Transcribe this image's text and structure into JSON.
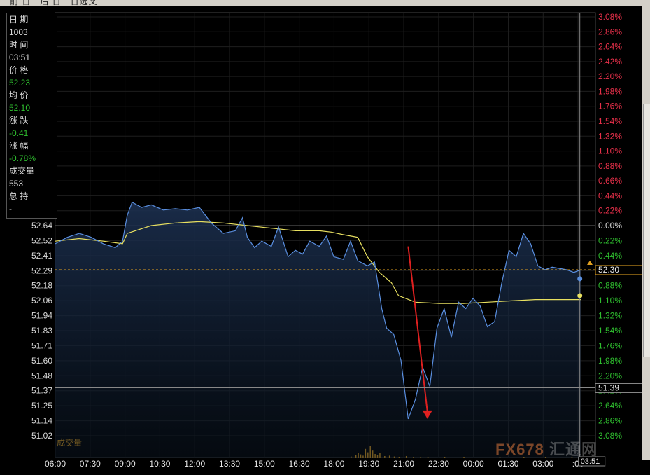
{
  "window": {
    "toolbar_text": "前 日   后 日   日选叉"
  },
  "info_panel": {
    "date_label": "日 期",
    "date_value": "1003",
    "time_label": "时 间",
    "time_value": "03:51",
    "price_label": "价 格",
    "price_value": "52.23",
    "avg_label": "均 价",
    "avg_value": "52.10",
    "change_label": "涨 跌",
    "change_value": "-0.41",
    "pct_label": "涨 幅",
    "pct_value": "-0.78%",
    "volume_label": "成交量",
    "volume_value": "553",
    "oi_label": "总 持",
    "oi_value": "-"
  },
  "volume_label": "成交量",
  "cursor_time_label": "03:51",
  "last_price_tag": "52.30",
  "crosshair_price_tag": "51.39",
  "watermark": {
    "prefix": "FX678",
    "suffix": "汇通网"
  },
  "colors": {
    "price_line": "#5a8fe0",
    "avg_line": "#e8e060",
    "up": "#e8304a",
    "down": "#2fbf2f",
    "arrow": "#e02020",
    "volume": "#e0a020"
  },
  "chart_data": {
    "type": "line",
    "title": "",
    "reference_price": 52.64,
    "ylim": [
      51.02,
      52.64
    ],
    "y_ticks_left": [
      "52.64",
      "52.52",
      "52.41",
      "52.29",
      "52.18",
      "52.06",
      "51.94",
      "51.83",
      "51.71",
      "51.60",
      "51.48",
      "51.37",
      "51.25",
      "51.14",
      "51.02"
    ],
    "y_ticks_right_up": [
      "3.08%",
      "2.86%",
      "2.64%",
      "2.42%",
      "2.20%",
      "1.98%",
      "1.76%",
      "1.54%",
      "1.32%",
      "1.10%",
      "0.88%",
      "0.66%",
      "0.44%",
      "0.22%"
    ],
    "y_ticks_right_down": [
      "0.00%",
      "0.22%",
      "0.44%",
      "0.66%",
      "0.88%",
      "1.10%",
      "1.32%",
      "1.54%",
      "1.76%",
      "1.98%",
      "2.20%",
      "2.42%",
      "2.64%",
      "2.86%",
      "3.08%"
    ],
    "x_ticks": [
      "06:00",
      "07:30",
      "09:00",
      "10:30",
      "12:00",
      "13:30",
      "15:00",
      "16:30",
      "18:00",
      "19:30",
      "21:00",
      "22:30",
      "00:00",
      "01:30",
      "03:00",
      ":00"
    ],
    "price_series": {
      "name": "价格",
      "x_hours": [
        0,
        0.5,
        1,
        1.5,
        2,
        2.5,
        2.8,
        3,
        3.2,
        3.6,
        4,
        4.5,
        5,
        5.5,
        6,
        6.5,
        7,
        7.5,
        7.8,
        8,
        8.3,
        8.6,
        9,
        9.3,
        9.7,
        10,
        10.3,
        10.6,
        11,
        11.3,
        11.6,
        12,
        12.3,
        12.6,
        13,
        13.3,
        13.6,
        13.8,
        14.1,
        14.4,
        14.7,
        15,
        15.3,
        15.6,
        15.9,
        16.2,
        16.5,
        16.8,
        17.1,
        17.4,
        17.7,
        18,
        18.3,
        18.6,
        18.9,
        19.2,
        19.5,
        19.8,
        20.1,
        20.4,
        20.7,
        21,
        21.3,
        21.6,
        21.9
      ],
      "values": [
        52.5,
        52.55,
        52.58,
        52.55,
        52.5,
        52.47,
        52.52,
        52.72,
        52.82,
        52.78,
        52.8,
        52.76,
        52.77,
        52.76,
        52.78,
        52.66,
        52.58,
        52.6,
        52.7,
        52.55,
        52.47,
        52.52,
        52.48,
        52.63,
        52.4,
        52.45,
        52.42,
        52.52,
        52.48,
        52.56,
        52.4,
        52.38,
        52.52,
        52.37,
        52.33,
        52.36,
        52.0,
        51.85,
        51.8,
        51.6,
        51.15,
        51.3,
        51.55,
        51.4,
        51.85,
        52.0,
        51.78,
        52.05,
        52.0,
        52.08,
        52.02,
        51.86,
        51.9,
        52.2,
        52.45,
        52.4,
        52.58,
        52.5,
        52.33,
        52.3,
        52.32,
        52.31,
        52.3,
        52.28,
        52.3
      ]
    },
    "avg_series": {
      "name": "均价",
      "x_hours": [
        0,
        1,
        2,
        2.8,
        3,
        4,
        5,
        6,
        7,
        8,
        9,
        10,
        11,
        11.5,
        12,
        12.6,
        13,
        13.5,
        14,
        14.3,
        15,
        16,
        17,
        18,
        19,
        20,
        21,
        21.9
      ],
      "values": [
        52.52,
        52.54,
        52.52,
        52.5,
        52.58,
        52.64,
        52.66,
        52.67,
        52.66,
        52.64,
        52.62,
        52.6,
        52.6,
        52.59,
        52.57,
        52.55,
        52.4,
        52.28,
        52.2,
        52.1,
        52.05,
        52.04,
        52.04,
        52.05,
        52.06,
        52.07,
        52.07,
        52.07
      ]
    },
    "volume_hours": [
      12.3,
      12.5,
      12.6,
      12.7,
      12.8,
      12.9,
      13.0,
      13.1,
      13.2,
      13.3,
      13.4,
      13.5,
      13.7,
      13.9,
      14.1,
      14.3,
      14.6,
      14.9,
      15.2,
      15.5,
      16.2,
      17.0,
      18.5,
      19.5,
      20.4,
      21.5
    ],
    "volume_values": [
      40,
      80,
      120,
      90,
      60,
      220,
      140,
      300,
      180,
      100,
      70,
      120,
      50,
      60,
      40,
      30,
      50,
      20,
      30,
      25,
      20,
      15,
      10,
      10,
      8,
      6
    ],
    "x_total_hours": 22.5,
    "cursor_hour": 21.85,
    "annotation": {
      "type": "arrow",
      "from": [
        14.7,
        52.48
      ],
      "to": [
        15.5,
        51.15
      ]
    }
  }
}
